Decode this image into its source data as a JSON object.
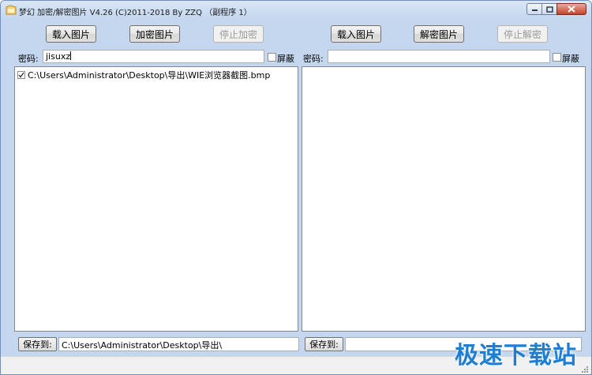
{
  "window": {
    "title": "梦幻 加密/解密图片 V4.26  (C)2011-2018 By ZZQ （副程序 1）"
  },
  "encrypt": {
    "load_label": "载入图片",
    "encrypt_label": "加密图片",
    "stop_label": "停止加密",
    "password_label": "密码:",
    "password_value": "jisuxz",
    "mask_label": "屏蔽",
    "files": [
      "C:\\Users\\Administrator\\Desktop\\导出\\WIE浏览器截图.bmp"
    ],
    "save_label": "保存到:",
    "save_path": "C:\\Users\\Administrator\\Desktop\\导出\\"
  },
  "decrypt": {
    "load_label": "载入图片",
    "decrypt_label": "解密图片",
    "stop_label": "停止解密",
    "password_label": "密码:",
    "password_value": "",
    "mask_label": "屏蔽",
    "save_label": "保存到:",
    "save_path": ""
  },
  "watermark": "极速下载站",
  "colors": {
    "window_bg": "#c4d7ee",
    "watermark": "#1e7ed1"
  }
}
